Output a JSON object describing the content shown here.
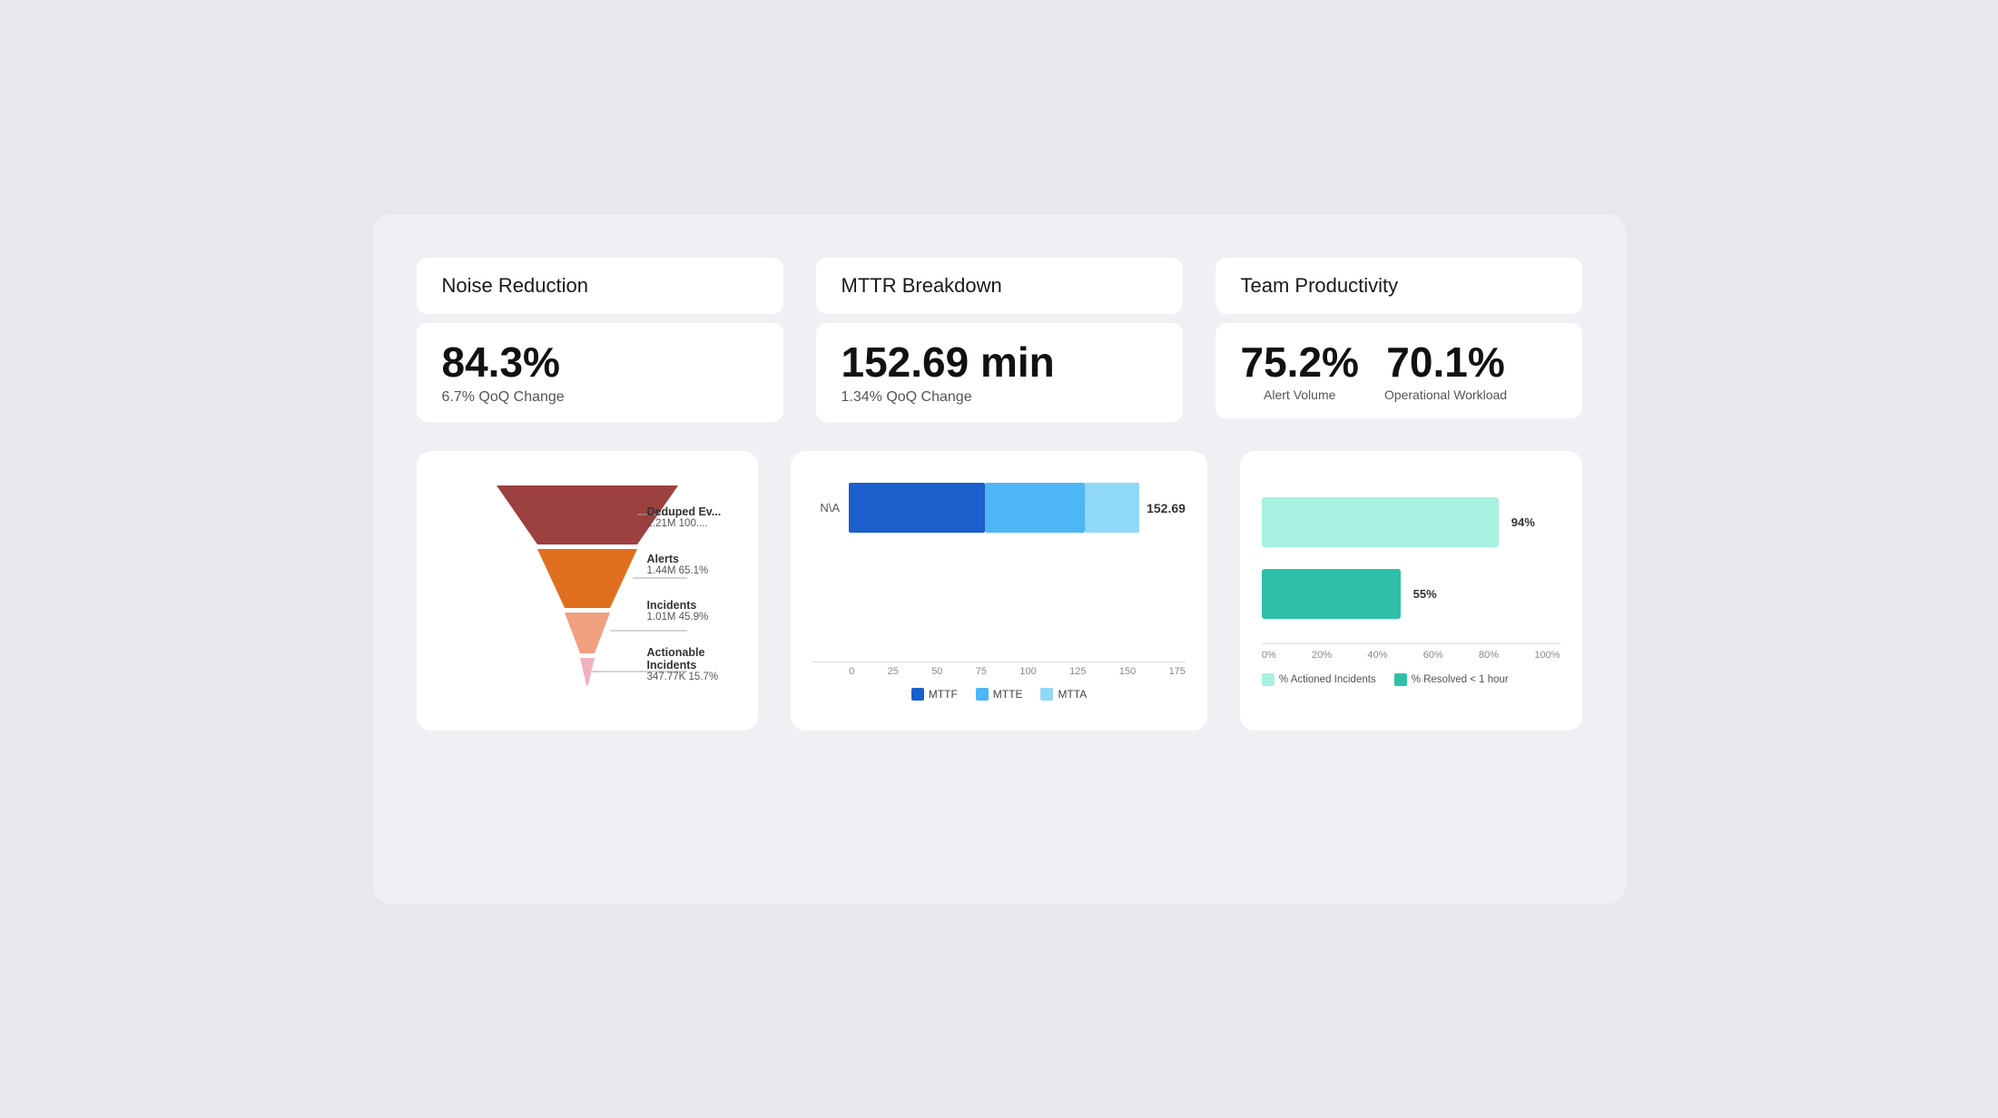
{
  "noise_reduction": {
    "title": "Noise Reduction",
    "value": "84.3%",
    "sub": "6.7% QoQ Change"
  },
  "mttr_breakdown": {
    "title": "MTTR Breakdown",
    "value": "152.69 min",
    "sub": "1.34% QoQ Change"
  },
  "team_productivity": {
    "title": "Team Productivity",
    "alert_volume_value": "75.2%",
    "alert_volume_label": "Alert Volume",
    "operational_value": "70.1%",
    "operational_label": "Operational Workload"
  },
  "funnel": {
    "label1_name": "Deduped Ev...",
    "label1_val": "2.21M 100....",
    "label2_name": "Alerts",
    "label2_val": "1.44M 65.1%",
    "label3_name": "Incidents",
    "label3_val": "1.01M 45.9%",
    "label4_name": "Actionable Incidents",
    "label4_val": "347.77K 15.7%"
  },
  "mttr_chart": {
    "row_label": "N\\A",
    "value_label": "152.69",
    "x_axis": [
      "0",
      "25",
      "50",
      "75",
      "100",
      "125",
      "150",
      "175"
    ],
    "legend": [
      {
        "name": "MTTF",
        "color": "#1a5fcc"
      },
      {
        "name": "MTTE",
        "color": "#4db6f5"
      },
      {
        "name": "MTTA",
        "color": "#90d8f8"
      }
    ]
  },
  "prod_chart": {
    "bar1_label": "94%",
    "bar1_pct": 94,
    "bar2_label": "55%",
    "bar2_pct": 55,
    "x_axis": [
      "0%",
      "20%",
      "40%",
      "60%",
      "80%",
      "100%"
    ],
    "legend": [
      {
        "name": "% Actioned Incidents",
        "color": "#a8f0e0"
      },
      {
        "name": "% Resolved < 1 hour",
        "color": "#2dbfa8"
      }
    ]
  }
}
